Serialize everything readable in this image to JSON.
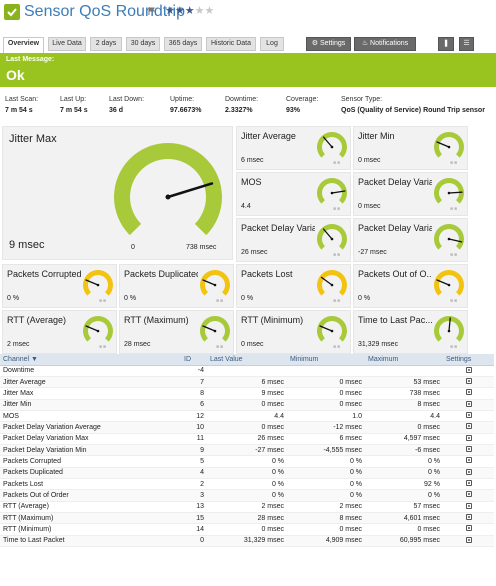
{
  "header": {
    "title": "Sensor QoS Roundtrip",
    "rating": 3,
    "rating_max": 5,
    "check_icon": "check-icon",
    "flag_icon": "flag-icon",
    "accent": "#8ab21d"
  },
  "tabs": [
    {
      "label": "Overview",
      "active": true
    },
    {
      "label": "Live Data"
    },
    {
      "label": "2 days"
    },
    {
      "label": "30 days"
    },
    {
      "label": "365 days"
    },
    {
      "label": "Historic Data"
    },
    {
      "label": "Log"
    }
  ],
  "actions": {
    "settings_label": "Settings",
    "notifications_label": "Notifications"
  },
  "message": {
    "label": "Last Message:",
    "value": "Ok",
    "color": "#99c31f"
  },
  "stats": [
    {
      "label": "Last Scan:",
      "value": "7 m 54 s"
    },
    {
      "label": "Last Up:",
      "value": "7 m 54 s"
    },
    {
      "label": "Last Down:",
      "value": "36 d"
    },
    {
      "label": "Uptime:",
      "value": "97.6673%"
    },
    {
      "label": "Downtime:",
      "value": "2.3327%"
    },
    {
      "label": "Coverage:",
      "value": "93%"
    },
    {
      "label": "Sensor Type:",
      "value": "QoS (Quality of Service) Round Trip sensor"
    }
  ],
  "primary_gauge": {
    "title": "Jitter Max",
    "value": "9 msec",
    "min_label": "0",
    "max_label": "738 msec",
    "fraction": 0.77
  },
  "gauges": [
    {
      "title": "Jitter Average",
      "value": "6 msec",
      "color": "#a7c93a",
      "fraction": 0.35
    },
    {
      "title": "Jitter Min",
      "value": "0 msec",
      "color": "#a7c93a",
      "fraction": 0.25
    },
    {
      "title": "MOS",
      "value": "4.4",
      "color": "#a7c93a",
      "fraction": 0.8
    },
    {
      "title": "Packet Delay Varia...",
      "value": "0 msec",
      "color": "#a7c93a",
      "fraction": 0.82
    },
    {
      "title": "Packet Delay Varia...",
      "value": "26 msec",
      "color": "#a7c93a",
      "fraction": 0.35
    },
    {
      "title": "Packet Delay Varia...",
      "value": "-27 msec",
      "color": "#a7c93a",
      "fraction": 0.88
    },
    {
      "title": "Packets Corrupted",
      "value": "0 %",
      "color": "#f2c311",
      "fraction": 0.25
    },
    {
      "title": "Packets Duplicated",
      "value": "0 %",
      "color": "#f2c311",
      "fraction": 0.25
    },
    {
      "title": "Packets Lost",
      "value": "0 %",
      "color": "#f2c311",
      "fraction": 0.3
    },
    {
      "title": "Packets Out of O...",
      "value": "0 %",
      "color": "#f2c311",
      "fraction": 0.25
    },
    {
      "title": "RTT (Average)",
      "value": "2 msec",
      "color": "#a7c93a",
      "fraction": 0.25
    },
    {
      "title": "RTT (Maximum)",
      "value": "28 msec",
      "color": "#a7c93a",
      "fraction": 0.25
    },
    {
      "title": "RTT (Minimum)",
      "value": "0 msec",
      "color": "#a7c93a",
      "fraction": 0.25
    },
    {
      "title": "Time to Last Pac...",
      "value": "31,329 msec",
      "color": "#a7c93a",
      "fraction": 0.52
    }
  ],
  "table": {
    "headers": [
      "Channel",
      "ID",
      "Last Value",
      "Minimum",
      "Maximum",
      "Settings"
    ],
    "rows": [
      [
        "Downtime",
        "-4",
        "",
        "",
        ""
      ],
      [
        "Jitter Average",
        "7",
        "6 msec",
        "0 msec",
        "53 msec"
      ],
      [
        "Jitter Max",
        "8",
        "9 msec",
        "0 msec",
        "738 msec"
      ],
      [
        "Jitter Min",
        "6",
        "0 msec",
        "0 msec",
        "8 msec"
      ],
      [
        "MOS",
        "12",
        "4.4",
        "1.0",
        "4.4"
      ],
      [
        "Packet Delay Variation Average",
        "10",
        "0 msec",
        "-12 msec",
        "0 msec"
      ],
      [
        "Packet Delay Variation Max",
        "11",
        "26 msec",
        "6 msec",
        "4,597 msec"
      ],
      [
        "Packet Delay Variation Min",
        "9",
        "-27 msec",
        "-4,555 msec",
        "-6 msec"
      ],
      [
        "Packets Corrupted",
        "5",
        "0 %",
        "0 %",
        "0 %"
      ],
      [
        "Packets Duplicated",
        "4",
        "0 %",
        "0 %",
        "0 %"
      ],
      [
        "Packets Lost",
        "2",
        "0 %",
        "0 %",
        "92 %"
      ],
      [
        "Packets Out of Order",
        "3",
        "0 %",
        "0 %",
        "0 %"
      ],
      [
        "RTT (Average)",
        "13",
        "2 msec",
        "2 msec",
        "57 msec"
      ],
      [
        "RTT (Maximum)",
        "15",
        "28 msec",
        "8 msec",
        "4,601 msec"
      ],
      [
        "RTT (Minimum)",
        "14",
        "0 msec",
        "0 msec",
        "0 msec"
      ],
      [
        "Time to Last Packet",
        "0",
        "31,329 msec",
        "4,909 msec",
        "60,995 msec"
      ]
    ]
  }
}
